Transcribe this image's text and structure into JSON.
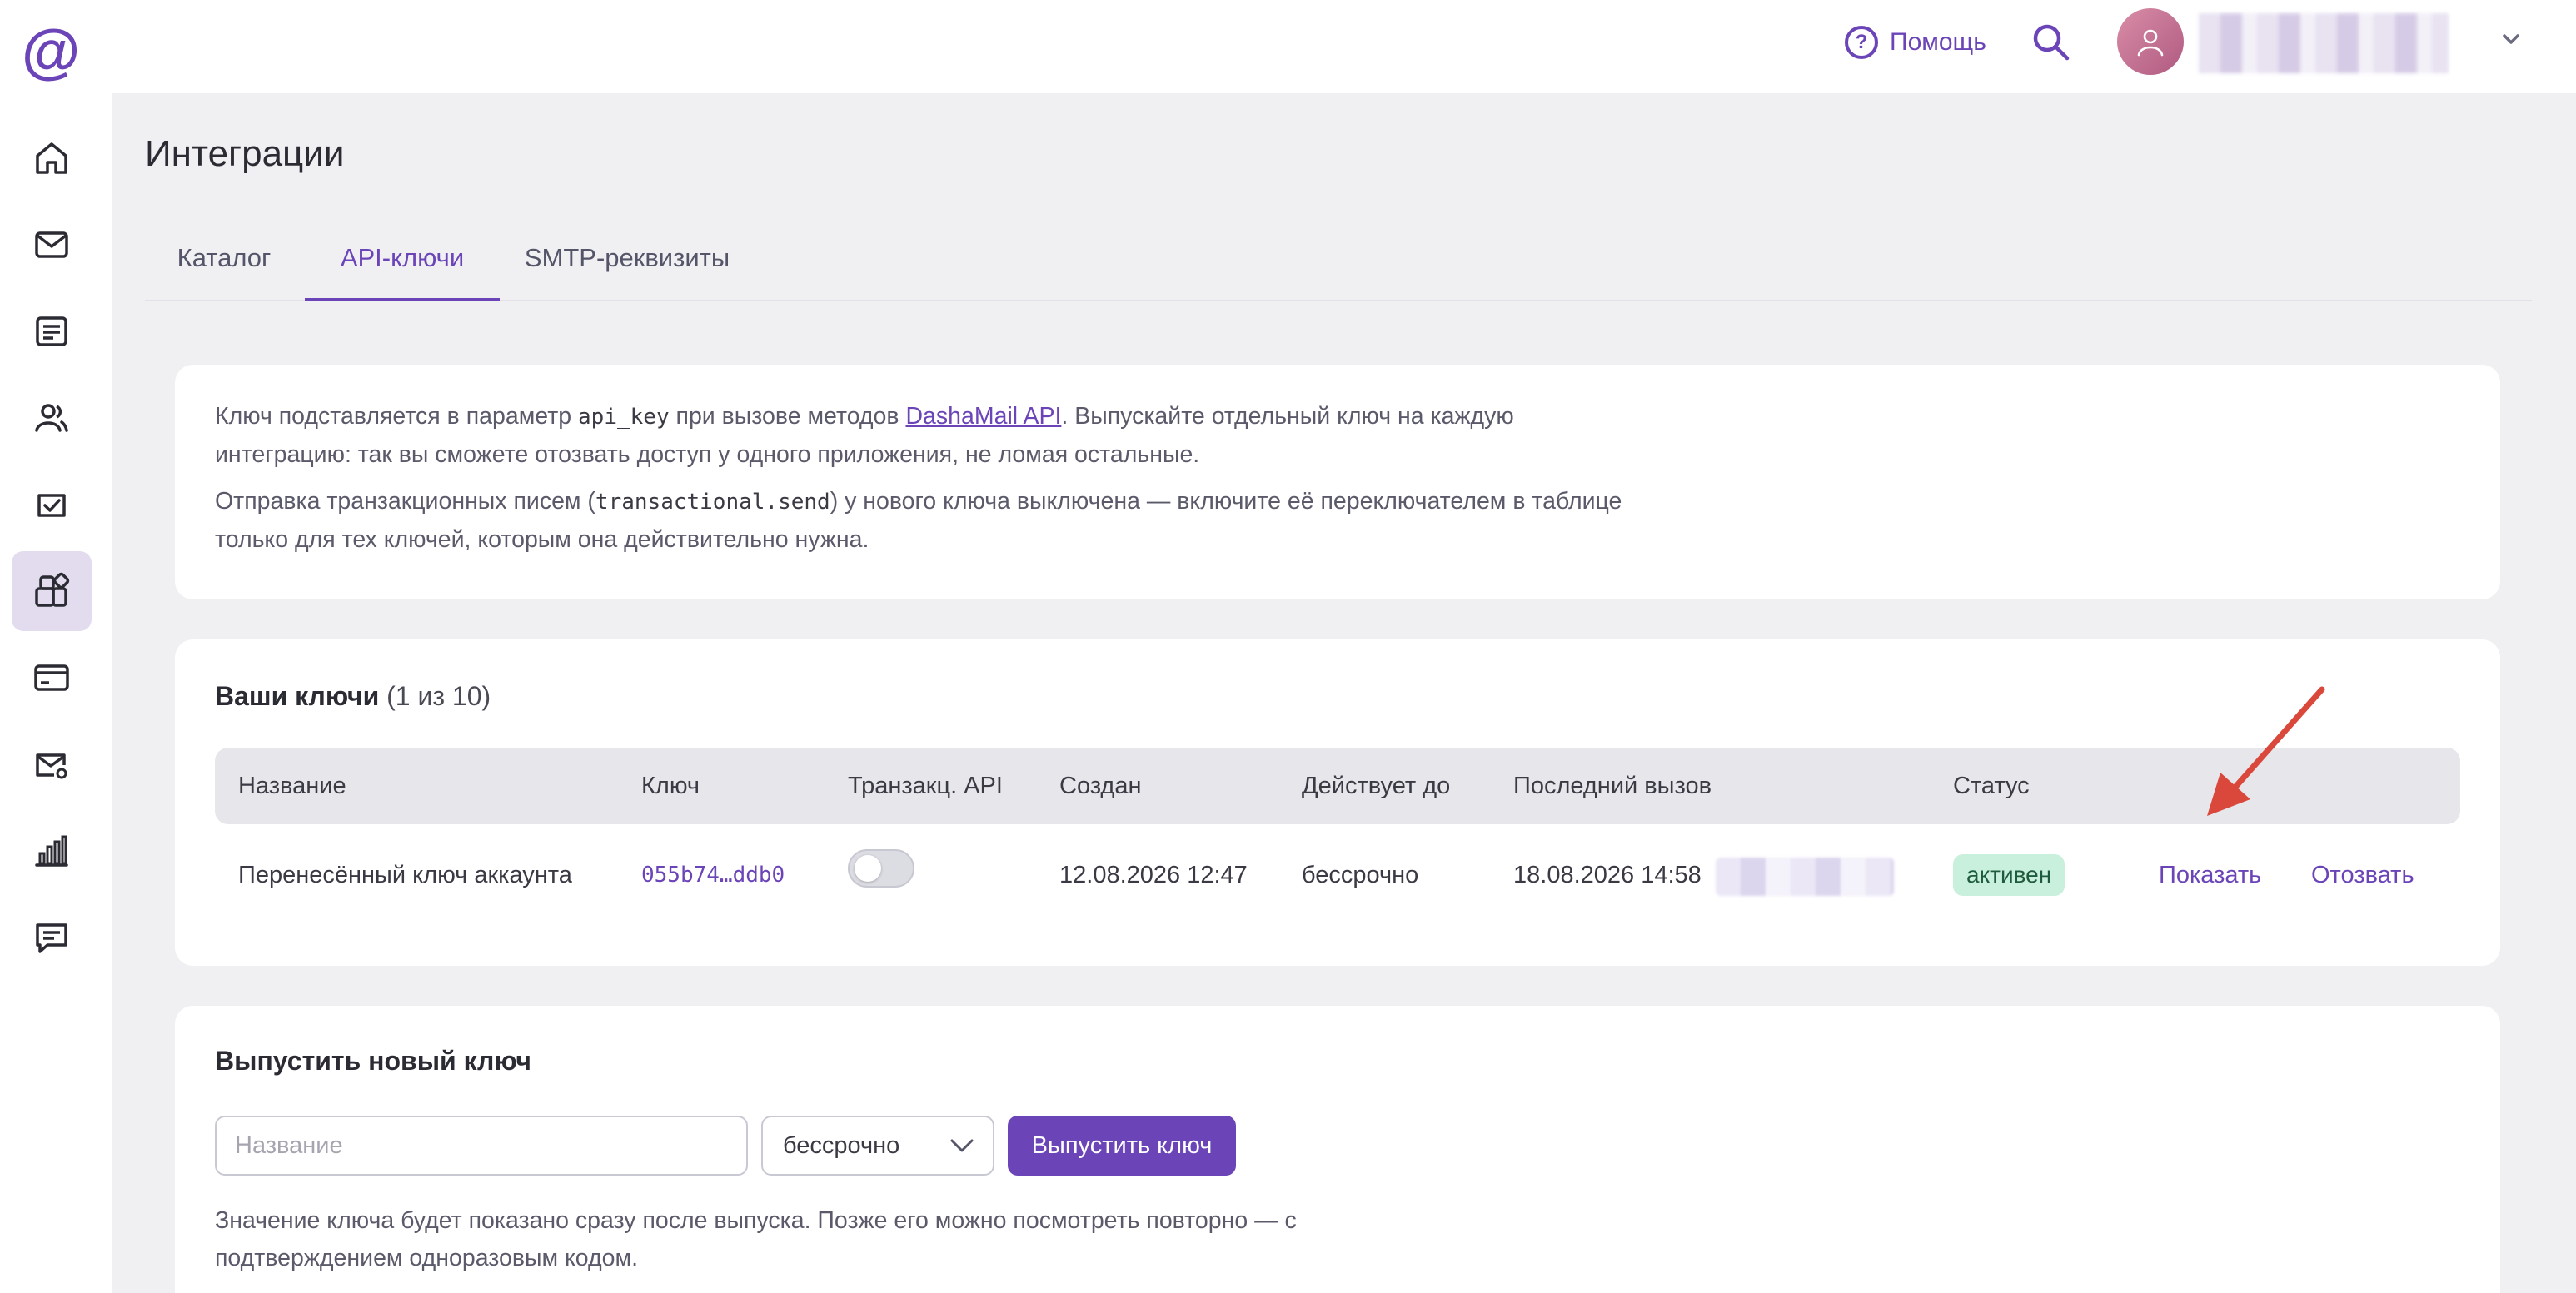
{
  "app": {
    "logo": "@"
  },
  "header": {
    "help_label": "Помощь"
  },
  "page": {
    "title": "Интеграции"
  },
  "tabs": [
    {
      "label": "Каталог"
    },
    {
      "label": "API-ключи"
    },
    {
      "label": "SMTP-реквизиты"
    }
  ],
  "info": {
    "p1_pre": "Ключ подставляется в параметр ",
    "p1_code": "api_key",
    "p1_mid": " при вызове методов ",
    "p1_link": "DashaMail API",
    "p1_post": ". Выпускайте отдельный ключ на каждую интеграцию: так вы сможете отозвать доступ у одного приложения, не ломая остальные.",
    "p2_pre": "Отправка транзакционных писем (",
    "p2_code": "transactional.send",
    "p2_post": ") у нового ключа выключена — включите её переключателем в таблице только для тех ключей, которым она действительно нужна."
  },
  "keys": {
    "title": "Ваши ключи",
    "count": "(1 из 10)",
    "columns": [
      "Название",
      "Ключ",
      "Транзакц. API",
      "Создан",
      "Действует до",
      "Последний вызов",
      "Статус"
    ],
    "rows": [
      {
        "name": "Перенесённый ключ аккаунта",
        "key": "055b74…ddb0",
        "transactional_enabled": false,
        "created": "12.08.2026 12:47",
        "valid_until": "бессрочно",
        "last_call": "18.08.2026 14:58",
        "status": "активен",
        "show_label": "Показать",
        "revoke_label": "Отозвать"
      }
    ]
  },
  "new_key": {
    "title": "Выпустить новый ключ",
    "name_placeholder": "Название",
    "duration_value": "бессрочно",
    "submit_label": "Выпустить ключ",
    "note": "Значение ключа будет показано сразу после выпуска. Позже его можно посмотреть повторно — с подтверждением одноразовым кодом."
  },
  "colors": {
    "accent": "#6b45b8",
    "status_bg": "#c9f0dc",
    "annotation_arrow": "#d9483b"
  },
  "icons": {
    "sidebar": [
      "home-icon",
      "mail-icon",
      "list-icon",
      "users-icon",
      "task-check-icon",
      "integrations-icon",
      "billing-card-icon",
      "mail-settings-icon",
      "chart-icon",
      "chat-icon"
    ]
  }
}
